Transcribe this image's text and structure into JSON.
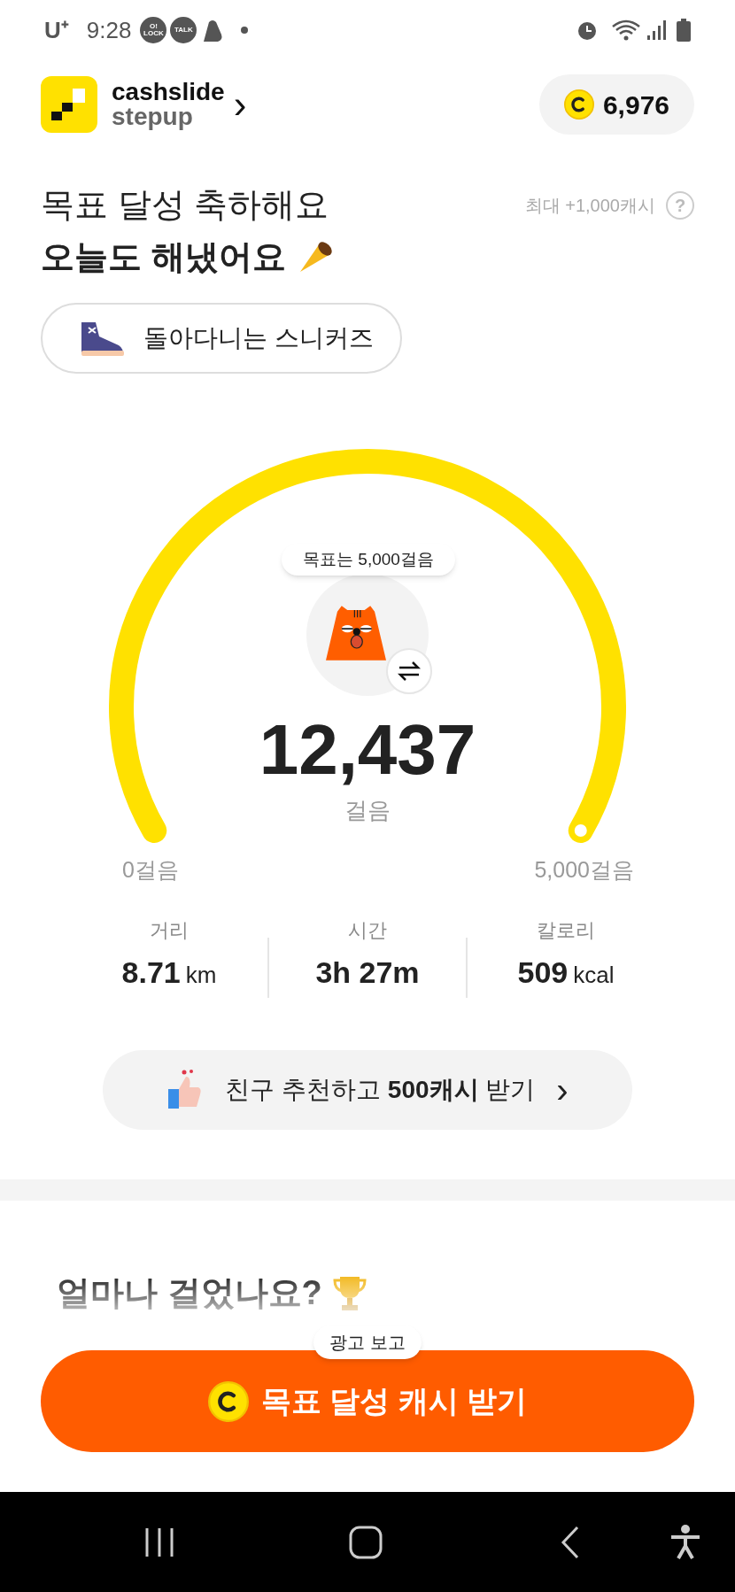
{
  "status_bar": {
    "carrier": "U⁺",
    "time": "9:28",
    "badges": [
      "O!\nLOCK",
      "TALK"
    ]
  },
  "header": {
    "brand_line_1": "cashslide",
    "brand_line_2": "stepup",
    "chevron": "›",
    "points": "6,976"
  },
  "hero": {
    "title": "목표 달성 축하해요",
    "subtitle": "오늘도 해냈어요",
    "max_reward": "최대 +1,000캐시",
    "help": "?",
    "badge_label": "돌아다니는 스니커즈"
  },
  "gauge": {
    "goal_bubble": "목표는 5,000걸음",
    "steps": "12,437",
    "steps_unit": "걸음",
    "min_label": "0걸음",
    "max_label": "5,000걸음"
  },
  "stats": [
    {
      "label": "거리",
      "value": "8.71",
      "unit": "km"
    },
    {
      "label": "시간",
      "value": "3h 27m"
    },
    {
      "label": "칼로리",
      "value": "509",
      "unit": "kcal"
    }
  ],
  "referral": {
    "text": "친구 추천하고 **500캐시** 받기",
    "chevron": "›"
  },
  "next_section": {
    "title": "얼마나 걸었나요?"
  },
  "cta": {
    "bubble": "광고 보고",
    "label": "목표 달성 캐시 받기"
  }
}
